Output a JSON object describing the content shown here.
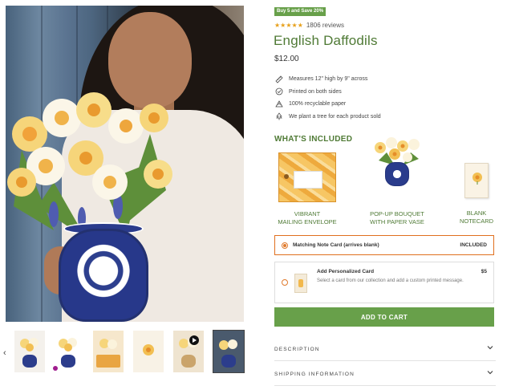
{
  "badge": "Buy 5 and Save 20%",
  "rating": {
    "stars": "★★★★★",
    "reviews": "1806 reviews"
  },
  "product": {
    "title": "English Daffodils",
    "price": "$12.00"
  },
  "features": [
    {
      "icon": "ruler-icon",
      "text": "Measures 12\" high by 9\" across"
    },
    {
      "icon": "double-sided-icon",
      "text": "Printed on both sides"
    },
    {
      "icon": "recycle-icon",
      "text": "100% recyclable paper"
    },
    {
      "icon": "tree-icon",
      "text": "We plant a tree for each product sold"
    }
  ],
  "included": {
    "title": "WHAT'S INCLUDED",
    "items": [
      {
        "line1": "VIBRANT",
        "line2": "MAILING ENVELOPE"
      },
      {
        "line1": "POP-UP BOUQUET",
        "line2": "WITH PAPER VASE"
      },
      {
        "line1": "BLANK",
        "line2": "NOTECARD"
      }
    ]
  },
  "options": [
    {
      "label": "Matching Note Card (arrives blank)",
      "value": "INCLUDED",
      "selected": true
    },
    {
      "label": "Add Personalized Card",
      "value": "$5",
      "description": "Select a card from our collection and add a custom printed message.",
      "selected": false
    }
  ],
  "add_to_cart": "ADD TO CART",
  "accordions": [
    {
      "label": "DESCRIPTION"
    },
    {
      "label": "SHIPPING INFORMATION"
    }
  ],
  "gallery": {
    "prev_arrow": "‹",
    "thumbnails": [
      "bouquet-with-box",
      "bouquet-front",
      "bouquet-envelope",
      "note-card",
      "bouquet-gift-set",
      "video-model"
    ],
    "active_thumbnail": 5
  },
  "colors": {
    "brand_green": "#4f7a35",
    "button_green": "#68a04a",
    "star": "#e7a01b",
    "selected_border": "#e0701f"
  }
}
